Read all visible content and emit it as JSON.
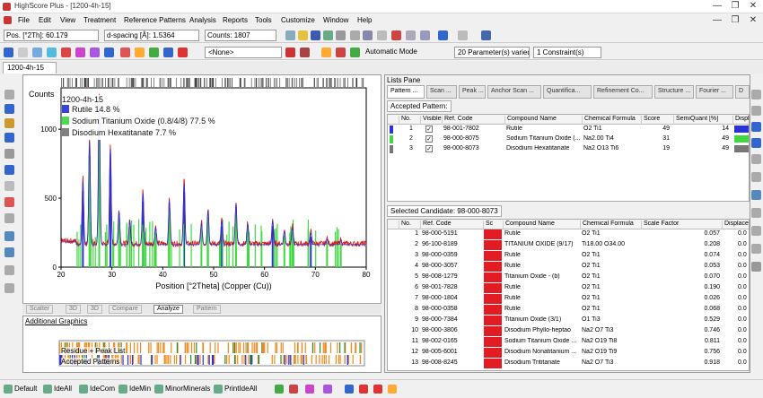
{
  "window": {
    "title": "HighScore Plus - [1200-4h-15]",
    "minimize": "—",
    "restore": "❐",
    "close": "✕"
  },
  "menu": [
    "File",
    "Edit",
    "View",
    "Treatment",
    "Reference Patterns",
    "Analysis",
    "Reports",
    "Tools",
    "Customize",
    "Window",
    "Help"
  ],
  "status_fields": {
    "position": "Pos. [°2Th]: 60.179",
    "dspacing": "d-spacing [Å]: 1.5364",
    "counts": "Counts: 1807"
  },
  "toolbar2": {
    "none_dropdown": "<None>",
    "mode": "Automatic Mode",
    "parameters": "20 Parameter(s) varied",
    "constraints": "1 Constraint(s)"
  },
  "document_tab": "1200-4h-15",
  "chart_data": {
    "type": "line",
    "title": "1200-4h-15",
    "ylabel": "Counts",
    "xlabel": "Position [°2Theta] (Copper (Cu))",
    "xlim": [
      20,
      80
    ],
    "ylim": [
      0,
      1300
    ],
    "xticks": [
      20,
      30,
      40,
      50,
      60,
      70,
      80
    ],
    "yticks": [
      0,
      500,
      1000
    ],
    "legend": [
      {
        "name": "Rutile 14.8 %",
        "color": "#2a33d6"
      },
      {
        "name": "Sodium Titanium Oxide (0.8/4/8) 77.5 %",
        "color": "#40d840"
      },
      {
        "name": "Disodium Hexatitanate 7.7 %",
        "color": "#777777"
      }
    ],
    "observed_peaks": [
      [
        24.3,
        650
      ],
      [
        25.6,
        950
      ],
      [
        27.5,
        1280
      ],
      [
        29.7,
        900
      ],
      [
        31.4,
        420
      ],
      [
        33.5,
        350
      ],
      [
        36.1,
        560
      ],
      [
        38.6,
        300
      ],
      [
        41.3,
        500
      ],
      [
        44.2,
        640
      ],
      [
        47.6,
        330
      ],
      [
        48.9,
        430
      ],
      [
        51.6,
        350
      ],
      [
        54.4,
        480
      ],
      [
        56.7,
        330
      ],
      [
        61.6,
        350
      ],
      [
        63.9,
        270
      ],
      [
        65.5,
        300
      ],
      [
        69.1,
        260
      ],
      [
        72.3,
        210
      ],
      [
        75.0,
        200
      ]
    ],
    "baseline": 170,
    "series_colors": {
      "observed": "#e01515",
      "calculated": "#1d30e0",
      "difference": "#222222"
    }
  },
  "plot_tabs": [
    "Scatter",
    "3D",
    "3D",
    "Compare",
    "Analyze",
    "Pattern"
  ],
  "additional_graphics": {
    "title": "Additional Graphics",
    "label1": "Residue + Peak List",
    "label2": "Accepted Patterns"
  },
  "lists": {
    "title": "Lists Pane",
    "tabs": [
      "Pattern ...",
      "Scan ...",
      "Peak ...",
      "Anchor Scan ...",
      "Quantifica...",
      "Refinement Co...",
      "Structure ...",
      "Fourier ...",
      "D"
    ],
    "accepted": {
      "title": "Accepted Pattern:",
      "headers": [
        "No.",
        "Visible",
        "Ref. Code",
        "Compound Name",
        "Chemical Formula",
        "Score",
        "SemiQuant [%]",
        "Displ"
      ],
      "rows": [
        {
          "no": "1",
          "code": "98-001-7802",
          "name": "Rutile",
          "formula": "O2 Ti1",
          "score": "49",
          "semi": "14",
          "color": "#2a33d6"
        },
        {
          "no": "2",
          "code": "98-000-8075",
          "name": "Sodium Titanium Oxide (...",
          "formula": "Na2.00 Ti4",
          "score": "31",
          "semi": "49",
          "color": "#40d840"
        },
        {
          "no": "3",
          "code": "98-000-8073",
          "name": "Disodium Hexatitanate",
          "formula": "Na2 O13 Ti6",
          "score": "19",
          "semi": "49",
          "color": "#777777"
        }
      ]
    },
    "candidates": {
      "title": "Selected Candidate: 98-000-8073",
      "headers": [
        "No.",
        "Ref. Code",
        "Sc",
        "Compound Name",
        "Chemical Formula",
        "Scale Factor",
        "Displacement [°2"
      ],
      "rows": [
        {
          "no": "1",
          "code": "98-000-5191",
          "name": "Rutile",
          "formula": "O2 Ti1",
          "scale": "0.057",
          "disp": "0.0"
        },
        {
          "no": "2",
          "code": "96-100-8189",
          "name": "TITANIUM OXIDE (9/17)",
          "formula": "Ti18.00 O34.00",
          "scale": "0.208",
          "disp": "0.0"
        },
        {
          "no": "3",
          "code": "98-000-0359",
          "name": "Rutile",
          "formula": "O2 Ti1",
          "scale": "0.074",
          "disp": "0.0"
        },
        {
          "no": "4",
          "code": "98-000-3057",
          "name": "Rutile",
          "formula": "O2 Ti1",
          "scale": "0.053",
          "disp": "0.0"
        },
        {
          "no": "5",
          "code": "98-008-1279",
          "name": "Titanium Oxide - (b)",
          "formula": "O2 Ti1",
          "scale": "0.070",
          "disp": "0.0"
        },
        {
          "no": "6",
          "code": "98-001-7828",
          "name": "Rutile",
          "formula": "O2 Ti1",
          "scale": "0.190",
          "disp": "0.0"
        },
        {
          "no": "7",
          "code": "98-000-1804",
          "name": "Rutile",
          "formula": "O2 Ti1",
          "scale": "0.026",
          "disp": "0.0"
        },
        {
          "no": "8",
          "code": "98-000-0358",
          "name": "Rutile",
          "formula": "O2 Ti1",
          "scale": "0.068",
          "disp": "0.0"
        },
        {
          "no": "9",
          "code": "98-000-7384",
          "name": "Titanium Oxide (3/1)",
          "formula": "O1 Ti3",
          "scale": "0.529",
          "disp": "0.0"
        },
        {
          "no": "10",
          "code": "98-000-3806",
          "name": "Disodium Phyllo-heptao",
          "formula": "Na2 O7 Ti3",
          "scale": "0.746",
          "disp": "0.0"
        },
        {
          "no": "11",
          "code": "98-002-0165",
          "name": "Sodium Titanium Oxide ...",
          "formula": "Na2 O19 Ti8",
          "scale": "0.811",
          "disp": "0.0"
        },
        {
          "no": "12",
          "code": "98-005-6001",
          "name": "Disodium Nonatitanium ...",
          "formula": "Na2 O19 Ti9",
          "scale": "0.756",
          "disp": "0.0"
        },
        {
          "no": "13",
          "code": "98-008-8245",
          "name": "Disodium Trititanate",
          "formula": "Na2 O7 Ti3",
          "scale": "0.918",
          "disp": "0.0"
        }
      ]
    }
  },
  "bottombar": [
    "Default",
    "IdeAll",
    "IdeCom",
    "IdeMin",
    "MinorMinerals",
    "PrintIdeAll"
  ]
}
